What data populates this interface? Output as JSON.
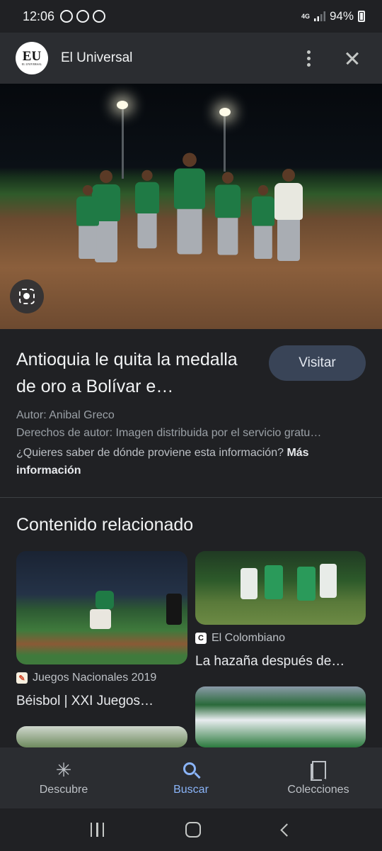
{
  "status_bar": {
    "time": "12:06",
    "network": "4G",
    "battery": "94%",
    "notification_icons": [
      "whatsapp-icon",
      "circle-app-icon",
      "soccer-ball-icon"
    ]
  },
  "header": {
    "logo_text": "EU",
    "logo_subtext": "EL UNIVERSAL",
    "source_name": "El Universal"
  },
  "article": {
    "title": "Antioquia le quita la medalla de oro a Bolívar e…",
    "visit_label": "Visitar",
    "author": "Autor: Anibal Greco",
    "copyright": "Derechos de autor: Imagen distribuida por el servicio gratu…",
    "question": "¿Quieres saber de dónde proviene esta información?",
    "more_info": "Más información"
  },
  "related": {
    "heading": "Contenido relacionado",
    "items": [
      {
        "source": "Juegos Nacionales 2019",
        "title": "Béisbol | XXI Juegos…",
        "favicon": "juegos-favicon"
      },
      {
        "source": "El Colombiano",
        "title": "La hazaña después de…",
        "favicon": "C"
      }
    ]
  },
  "bottom_nav": {
    "items": [
      {
        "label": "Descubre",
        "icon": "asterisk-icon",
        "active": false
      },
      {
        "label": "Buscar",
        "icon": "search-icon",
        "active": true
      },
      {
        "label": "Colecciones",
        "icon": "collections-icon",
        "active": false
      }
    ]
  },
  "colors": {
    "background": "#202124",
    "accent": "#8ab4f8",
    "visit_button": "#394457",
    "uniform_green": "#1f7a45"
  }
}
